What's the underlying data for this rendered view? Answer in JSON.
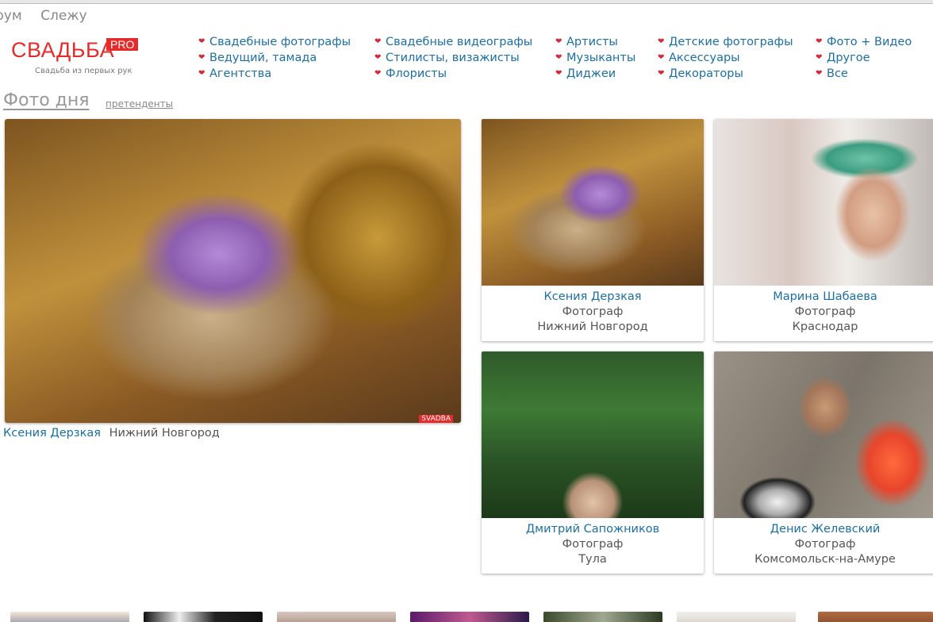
{
  "topnav": [
    "рум",
    "Слежу"
  ],
  "logo": {
    "main": "СВАДЬБА",
    "badge": "PRO",
    "tagline": "Свадьба из первых рук"
  },
  "categories": [
    [
      "Свадебные фотографы",
      "Ведущий, тамада",
      "Агентства"
    ],
    [
      "Свадебные видеографы",
      "Стилисты, визажисты",
      "Флористы"
    ],
    [
      "Артисты",
      "Музыканты",
      "Диджеи"
    ],
    [
      "Детские фотографы",
      "Аксессуары",
      "Декораторы"
    ],
    [
      "Фото + Видео",
      "Другое",
      "Все"
    ]
  ],
  "section": {
    "title": "Фото дня",
    "link": "претенденты"
  },
  "main_photo": {
    "watermark": "SVADBA",
    "author": "Ксения Дерзкая",
    "city": "Нижний Новгород"
  },
  "cards": [
    {
      "name": "Ксения Дерзкая",
      "role": "Фотограф",
      "city": "Нижний Новгород"
    },
    {
      "name": "Марина Шабаева",
      "role": "Фотограф",
      "city": "Краснодар"
    },
    {
      "name": "Дмитрий Сапожников",
      "role": "Фотограф",
      "city": "Тула"
    },
    {
      "name": "Денис Желевский",
      "role": "Фотограф",
      "city": "Комсомольск-на-Амуре"
    }
  ],
  "colors": {
    "brand": "#e52b2b",
    "link": "#1b6fa3",
    "heart": "#d7263a"
  }
}
